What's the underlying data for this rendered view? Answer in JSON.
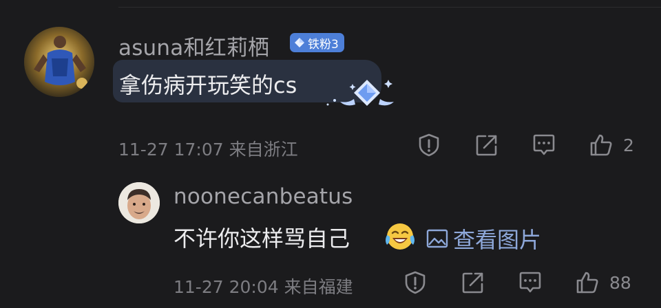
{
  "main_comment": {
    "username": "asuna和红莉栖",
    "badge": "铁粉3",
    "text": "拿伤病开玩笑的cs",
    "time": "11-27 17:07",
    "location": "来自浙江",
    "likes": "2"
  },
  "reply_comment": {
    "username": "noonecanbeatus",
    "text": "不许你这样骂自己",
    "image_link": "查看图片",
    "time": "11-27 20:04",
    "location": "来自福建",
    "likes": "88"
  },
  "icons": [
    "report-icon",
    "share-icon",
    "reply-icon",
    "like-icon",
    "image-icon",
    "laughing-crying-emoji"
  ],
  "colors": {
    "background": "#1b1b1d",
    "badge": "#4d7fd8",
    "bubble": "#2a3140",
    "link": "#8ea8da",
    "meta": "#7d7d82"
  }
}
